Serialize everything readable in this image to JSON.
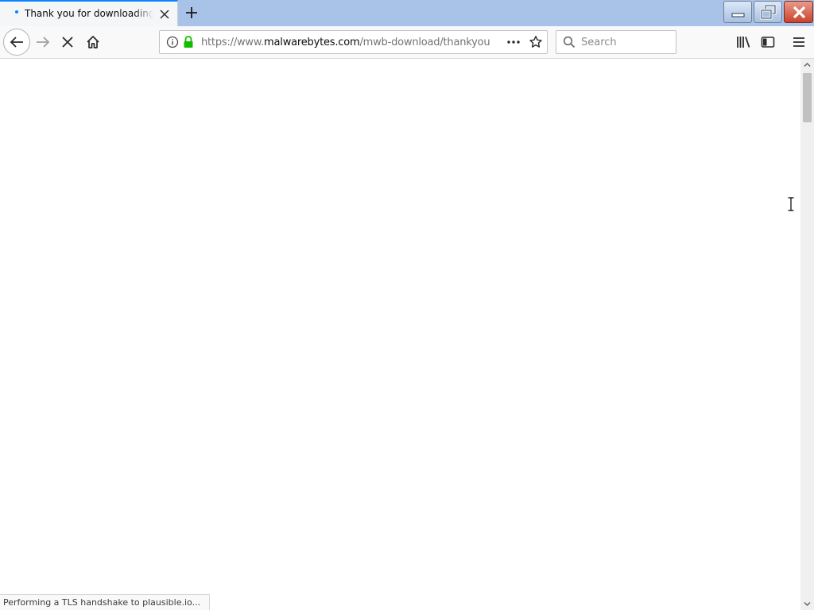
{
  "tab": {
    "title": "Thank you for downloading Malwarebytes",
    "loading": true
  },
  "navigation": {
    "url_scheme": "https://www.",
    "url_host": "malwarebytes.com",
    "url_path": "/mwb-download/thankyou",
    "secure": true
  },
  "search": {
    "placeholder": "Search"
  },
  "status": {
    "text": "Performing a TLS handshake to plausible.io..."
  },
  "colors": {
    "accent": "#0a84ff",
    "lock": "#12bc00",
    "close_button": "#c9432c"
  },
  "icons": [
    "tab-loading-dot-icon",
    "close-icon",
    "plus-icon",
    "minimize-icon",
    "restore-icon",
    "window-close-icon",
    "back-icon",
    "forward-icon",
    "stop-icon",
    "home-icon",
    "info-icon",
    "lock-icon",
    "page-actions-icon",
    "bookmark-star-icon",
    "search-icon",
    "library-icon",
    "sidebar-icon",
    "menu-icon"
  ]
}
